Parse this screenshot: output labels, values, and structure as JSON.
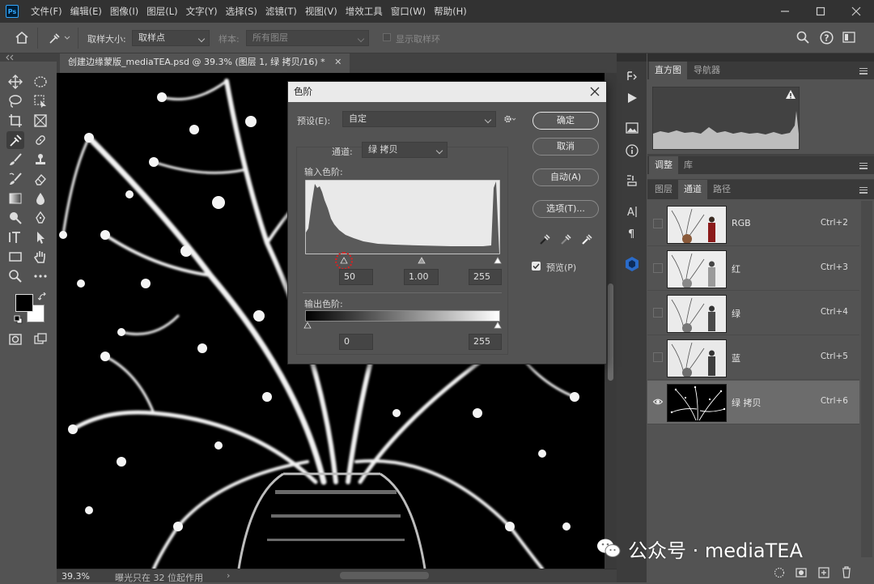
{
  "app": {
    "logo": "Ps",
    "brand_color": "#31a8ff"
  },
  "menubar": {
    "items": [
      "文件(F)",
      "编辑(E)",
      "图像(I)",
      "图层(L)",
      "文字(Y)",
      "选择(S)",
      "滤镜(T)",
      "视图(V)",
      "增效工具",
      "窗口(W)",
      "帮助(H)"
    ]
  },
  "options": {
    "sample_size_label": "取样大小:",
    "sample_size_value": "取样点",
    "sample_label": "样本:",
    "sample_value": "所有图层",
    "show_ring_label": "显示取样环"
  },
  "document": {
    "tab_title": "创建边缘蒙版_mediaTEA.psd @ 39.3% (图层 1, 绿 拷贝/16) *",
    "zoom": "39.3%",
    "status": "曝光只在 32 位起作用"
  },
  "panels": {
    "top_tabs": [
      "直方图",
      "导航器"
    ],
    "mid_tabs": [
      "调整",
      "库"
    ],
    "bottom_tabs": [
      "图层",
      "通道",
      "路径"
    ],
    "channels": [
      {
        "name": "RGB",
        "shortcut": "Ctrl+2",
        "visible": false,
        "selected": false,
        "thumb": "color"
      },
      {
        "name": "红",
        "shortcut": "Ctrl+3",
        "visible": false,
        "selected": false,
        "thumb": "gray"
      },
      {
        "name": "绿",
        "shortcut": "Ctrl+4",
        "visible": false,
        "selected": false,
        "thumb": "gray"
      },
      {
        "name": "蓝",
        "shortcut": "Ctrl+5",
        "visible": false,
        "selected": false,
        "thumb": "gray"
      },
      {
        "name": "绿 拷贝",
        "shortcut": "Ctrl+6",
        "visible": true,
        "selected": true,
        "thumb": "mask"
      }
    ]
  },
  "levels_dialog": {
    "title": "色阶",
    "preset_label": "预设(E):",
    "preset_value": "自定",
    "channel_label": "通道:",
    "channel_value": "绿 拷贝",
    "input_label": "输入色阶:",
    "input_black": "50",
    "input_gamma": "1.00",
    "input_white": "255",
    "output_label": "输出色阶:",
    "output_black": "0",
    "output_white": "255",
    "buttons": {
      "ok": "确定",
      "cancel": "取消",
      "auto": "自动(A)",
      "options": "选项(T)..."
    },
    "preview_label": "预览(P)",
    "preview_checked": true,
    "highlight_color": "#e02020"
  },
  "watermark": {
    "text": "公众号 · mediaTEA"
  }
}
